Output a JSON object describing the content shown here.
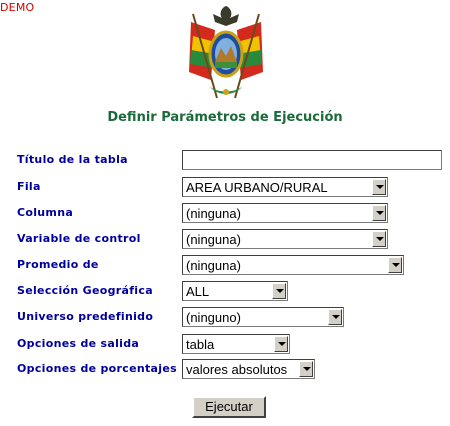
{
  "watermark": "DEMO",
  "page": {
    "heading": "Definir Parámetros de Ejecución"
  },
  "form": {
    "titulo": {
      "label": "Título de la tabla",
      "value": ""
    },
    "fila": {
      "label": "Fila",
      "value": "AREA URBANO/RURAL"
    },
    "columna": {
      "label": "Columna",
      "value": "(ninguna)"
    },
    "variable_control": {
      "label": "Variable de control",
      "value": "(ninguna)"
    },
    "promedio": {
      "label": "Promedio de",
      "value": "(ninguna)"
    },
    "seleccion_geografica": {
      "label": "Selección Geográfica",
      "value": "ALL"
    },
    "universo": {
      "label": "Universo predefinido",
      "value": "(ninguno)"
    },
    "opciones_salida": {
      "label": "Opciones de salida",
      "value": "tabla"
    },
    "opciones_porcentajes": {
      "label": "Opciones de porcentajes",
      "value": "valores absolutos"
    },
    "submit_label": "Ejecutar"
  },
  "icons": {
    "emblem": "bolivia-coat-of-arms-icon",
    "dropdown": "chevron-down-icon"
  }
}
